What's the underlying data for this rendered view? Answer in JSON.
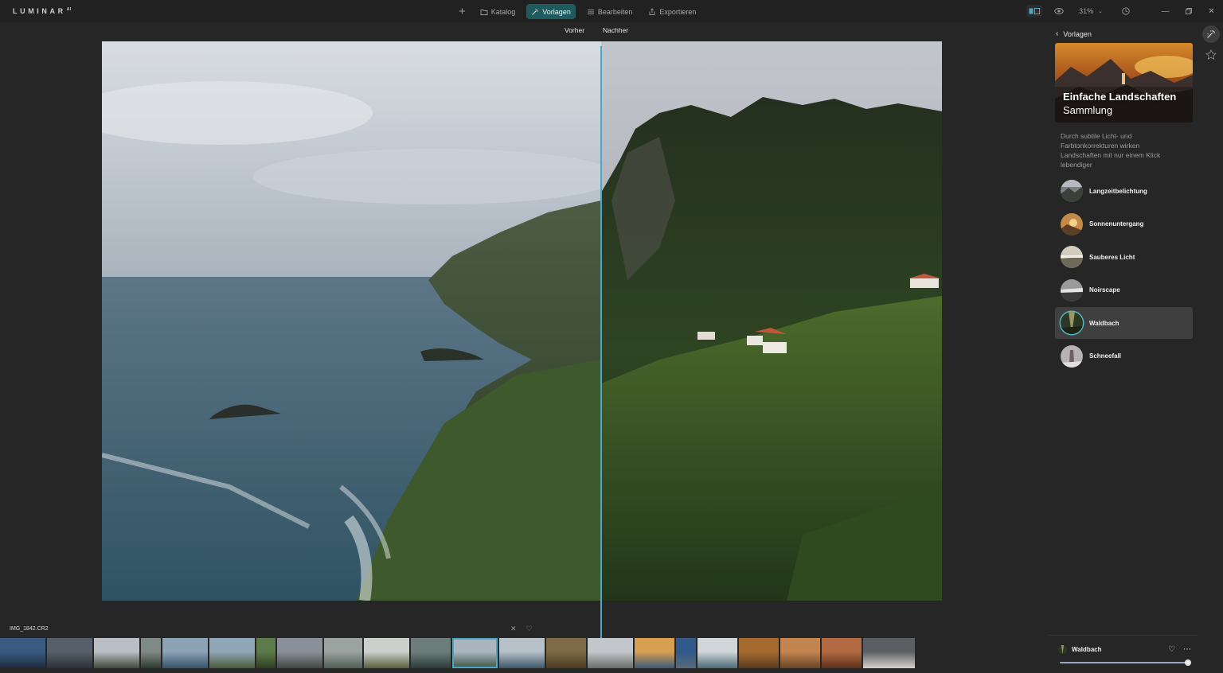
{
  "app": {
    "logo": "LUMINAR",
    "logo_sup": "AI"
  },
  "nav": {
    "tabs": [
      {
        "label": "Katalog",
        "icon": "folder-icon",
        "active": false
      },
      {
        "label": "Vorlagen",
        "icon": "magic-wand-icon",
        "active": true
      },
      {
        "label": "Bearbeiten",
        "icon": "sliders-icon",
        "active": false
      },
      {
        "label": "Exportieren",
        "icon": "export-icon",
        "active": false
      }
    ]
  },
  "toolbar": {
    "zoom": "31%"
  },
  "canvas": {
    "before_label": "Vorher",
    "after_label": "Nachher"
  },
  "panel": {
    "back_label": "Vorlagen",
    "collection_title": "Einfache Landschaften",
    "collection_subtitle": "Sammlung",
    "description": "Durch subtile Licht- und Farbtonkorrekturen wirken Landschaften mit nur einem Klick lebendiger",
    "presets": [
      {
        "label": "Langzeitbelichtung",
        "selected": false
      },
      {
        "label": "Sonnenuntergang",
        "selected": false
      },
      {
        "label": "Sauberes Licht",
        "selected": false
      },
      {
        "label": "Noirscape",
        "selected": false
      },
      {
        "label": "Waldbach",
        "selected": true
      },
      {
        "label": "Schneefall",
        "selected": false
      }
    ],
    "applied_preset": "Waldbach",
    "amount": 1.0
  },
  "filmstrip": {
    "file_name": "IMG_1842.CR2",
    "count": 21,
    "current_index": 11
  },
  "colors": {
    "accent": "#4aa7c5",
    "active_tab": "#1e5b5e",
    "background": "#262626"
  }
}
